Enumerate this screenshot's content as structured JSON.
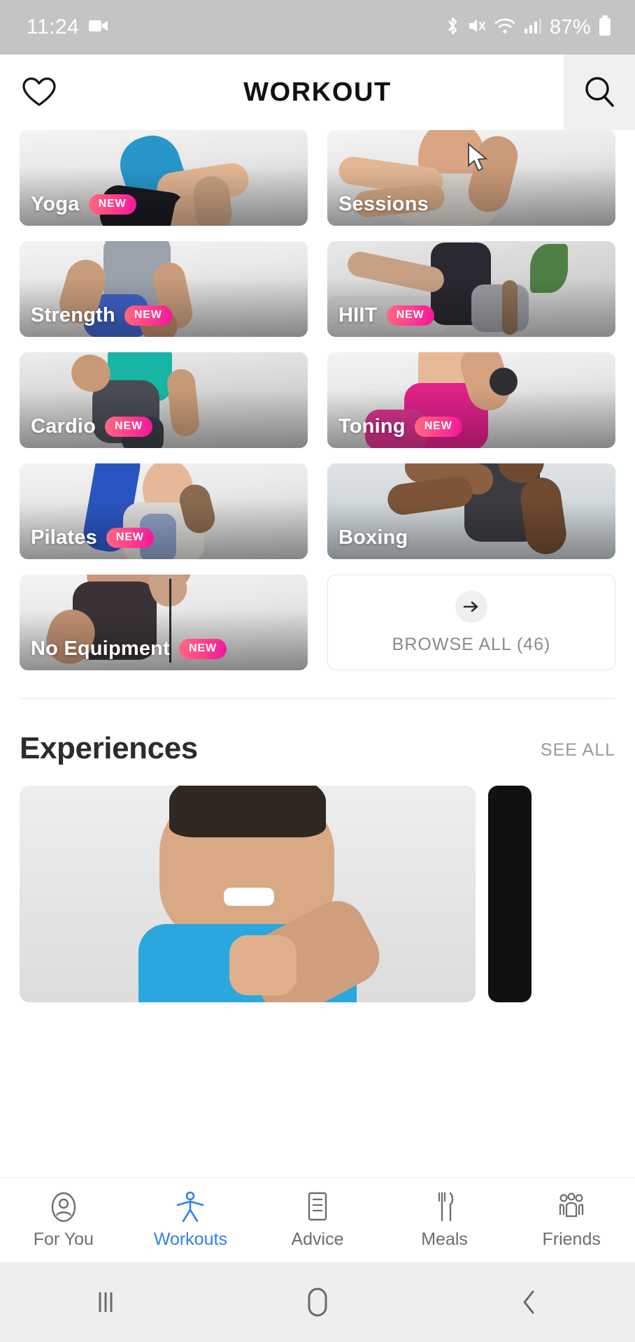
{
  "status_bar": {
    "time": "11:24",
    "battery_percent": "87%",
    "icons": [
      "video-camera-icon",
      "bluetooth-icon",
      "mute-icon",
      "wifi-icon",
      "cellular-signal-icon",
      "battery-icon"
    ]
  },
  "header": {
    "title": "WORKOUT",
    "favorite_icon": "heart-icon",
    "search_icon": "search-icon"
  },
  "categories": [
    {
      "label": "Yoga",
      "badge": "NEW"
    },
    {
      "label": "Sessions",
      "badge": ""
    },
    {
      "label": "Strength",
      "badge": "NEW"
    },
    {
      "label": "HIIT",
      "badge": "NEW"
    },
    {
      "label": "Cardio",
      "badge": "NEW"
    },
    {
      "label": "Toning",
      "badge": "NEW"
    },
    {
      "label": "Pilates",
      "badge": "NEW"
    },
    {
      "label": "Boxing",
      "badge": ""
    },
    {
      "label": "No Equipment",
      "badge": "NEW"
    }
  ],
  "browse_all": {
    "label": "BROWSE ALL (46)",
    "arrow_icon": "arrow-right-icon",
    "count": 46
  },
  "experiences": {
    "title": "Experiences",
    "see_all_label": "SEE ALL"
  },
  "tabs": [
    {
      "label": "For You",
      "icon": "person-circle-icon",
      "active": false
    },
    {
      "label": "Workouts",
      "icon": "exercise-person-icon",
      "active": true
    },
    {
      "label": "Advice",
      "icon": "document-lines-icon",
      "active": false
    },
    {
      "label": "Meals",
      "icon": "fork-knife-icon",
      "active": false
    },
    {
      "label": "Friends",
      "icon": "people-group-icon",
      "active": false
    }
  ],
  "android_nav": {
    "recents_icon": "recents-icon",
    "home_icon": "home-icon",
    "back_icon": "back-icon"
  },
  "colors": {
    "accent": "#2f80ed",
    "badge_start": "#ff6a7e",
    "badge_end": "#f0149e",
    "status_bar_bg": "#c4c4c4",
    "nav_bg": "#eeeeee"
  }
}
